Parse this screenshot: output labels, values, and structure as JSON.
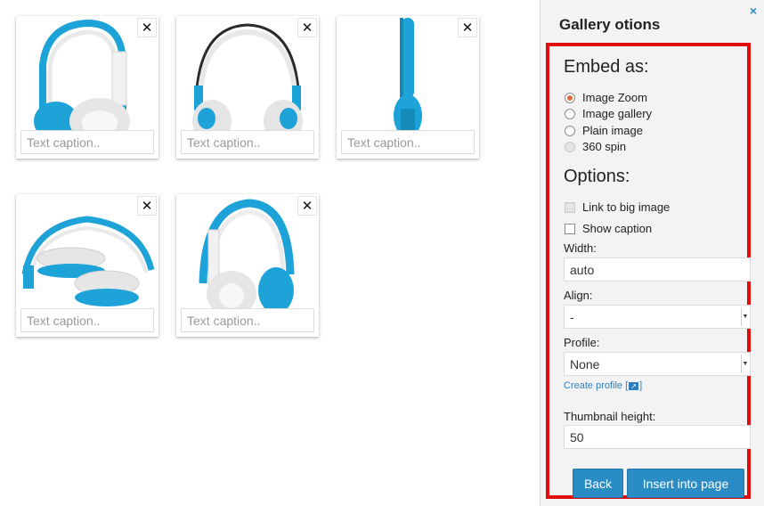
{
  "gallery": {
    "caption_placeholder": "Text caption..",
    "items": [
      {
        "id": "1",
        "icon": "headphones-side-icon"
      },
      {
        "id": "2",
        "icon": "headphones-front-icon"
      },
      {
        "id": "3",
        "icon": "headphones-edge-icon"
      },
      {
        "id": "4",
        "icon": "headphones-folded-icon"
      },
      {
        "id": "5",
        "icon": "headphones-three-quarter-icon"
      }
    ],
    "remove_glyph": "✕"
  },
  "panel": {
    "title": "Gallery otions",
    "close_glyph": "×",
    "embed_heading": "Embed as:",
    "embed_options": [
      {
        "label": "Image Zoom",
        "checked": true,
        "disabled": false
      },
      {
        "label": "Image gallery",
        "checked": false,
        "disabled": false
      },
      {
        "label": "Plain image",
        "checked": false,
        "disabled": false
      },
      {
        "label": "360 spin",
        "checked": false,
        "disabled": true
      }
    ],
    "options_heading": "Options:",
    "options": [
      {
        "label": "Link to big image",
        "checked": false,
        "disabled": true
      },
      {
        "label": "Show caption",
        "checked": false,
        "disabled": false
      }
    ],
    "width_label": "Width:",
    "width_value": "auto",
    "align_label": "Align:",
    "align_value": "-",
    "profile_label": "Profile:",
    "profile_value": "None",
    "create_profile_label": "Create profile [",
    "create_profile_suffix": "]",
    "thumb_height_label": "Thumbnail height:",
    "thumb_height_value": "50",
    "back_label": "Back",
    "insert_label": "Insert into page"
  },
  "colors": {
    "accent": "#2a8cc4",
    "highlight_border": "#e10d0d",
    "headphone_blue": "#1ea3d8",
    "radio_selected": "#e0693a"
  }
}
